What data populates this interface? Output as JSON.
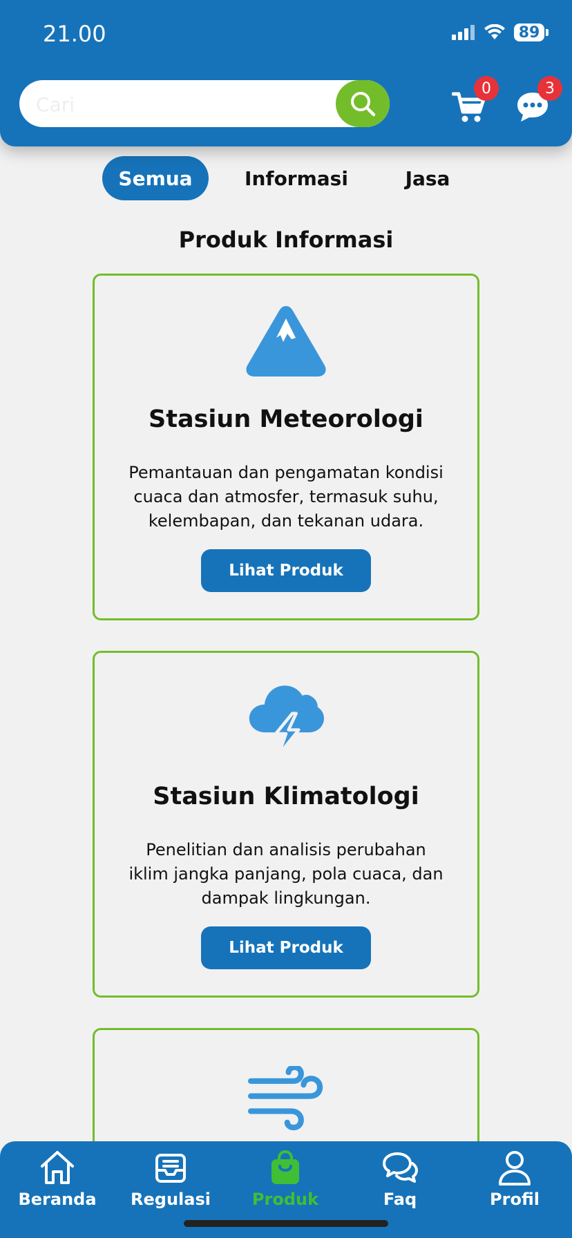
{
  "status_bar": {
    "time": "21.00",
    "battery": "89"
  },
  "search": {
    "placeholder": "Cari"
  },
  "header": {
    "cart_count": "0",
    "chat_count": "3"
  },
  "tabs": [
    {
      "label": "Semua",
      "active": true
    },
    {
      "label": "Informasi",
      "active": false
    },
    {
      "label": "Jasa",
      "active": false
    }
  ],
  "section_title": "Produk Informasi",
  "cards": [
    {
      "icon": "mountain-icon",
      "title": "Stasiun Meteorologi",
      "description": "Pemantauan dan pengamatan kondisi cuaca dan atmosfer, termasuk suhu, kelembapan, dan tekanan udara.",
      "button": "Lihat Produk"
    },
    {
      "icon": "cloud-lightning-icon",
      "title": "Stasiun Klimatologi",
      "description": "Penelitian dan analisis perubahan iklim jangka panjang, pola cuaca, dan dampak lingkungan.",
      "button": "Lihat Produk"
    },
    {
      "icon": "wind-icon"
    }
  ],
  "bottom_nav": [
    {
      "label": "Beranda",
      "icon": "home-icon"
    },
    {
      "label": "Regulasi",
      "icon": "inbox-icon"
    },
    {
      "label": "Produk",
      "icon": "shopping-bag-icon",
      "active": true
    },
    {
      "label": "Faq",
      "icon": "chat-bubbles-icon"
    },
    {
      "label": "Profil",
      "icon": "user-icon"
    }
  ],
  "colors": {
    "primary": "#1673b9",
    "accent": "#74bd2a",
    "badge": "#e8323a",
    "icon": "#3a96da"
  }
}
